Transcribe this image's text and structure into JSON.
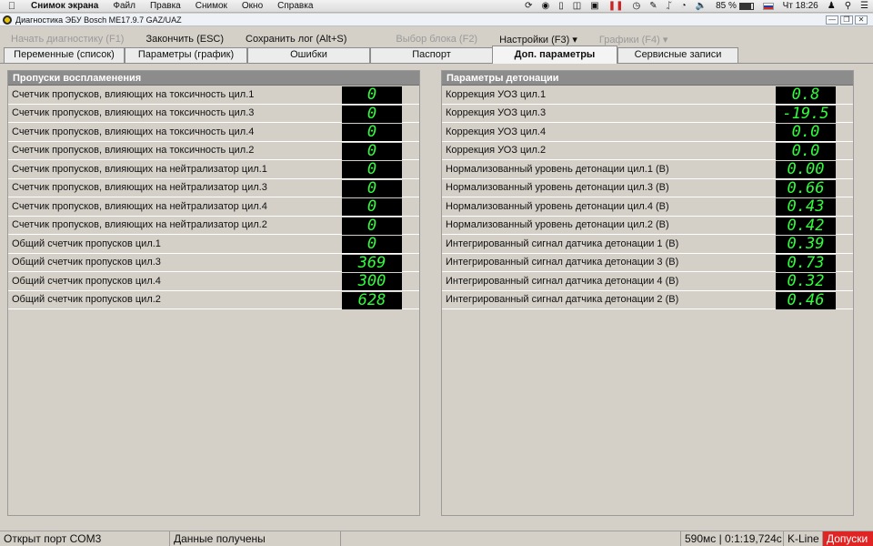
{
  "menubar": {
    "app_name": "Снимок экрана",
    "items": [
      "Файл",
      "Правка",
      "Снимок",
      "Окно",
      "Справка"
    ],
    "battery": "85 %",
    "clock": "Чт 18:26"
  },
  "window": {
    "title": "Диагностика ЭБУ Bosch ME17.9.7 GAZ/UAZ"
  },
  "toolbar": {
    "start_diag": "Начать диагностику (F1)",
    "finish": "Закончить (ESC)",
    "save_log": "Сохранить лог (Alt+S)",
    "select_block": "Выбор блока (F2)",
    "settings": "Настройки (F3)",
    "graphs": "Графики (F4)"
  },
  "tabs": [
    "Переменные (список)",
    "Параметры (график)",
    "Ошибки",
    "Паспорт",
    "Доп. параметры",
    "Сервисные записи"
  ],
  "active_tab": "Доп. параметры",
  "left_panel": {
    "title": "Пропуски воспламенения",
    "rows": [
      {
        "label": "Счетчик пропусков, влияющих на токсичность цил.1",
        "value": "0"
      },
      {
        "label": "Счетчик пропусков, влияющих на токсичность цил.3",
        "value": "0"
      },
      {
        "label": "Счетчик пропусков, влияющих на токсичность цил.4",
        "value": "0"
      },
      {
        "label": "Счетчик пропусков, влияющих на токсичность цил.2",
        "value": "0"
      },
      {
        "label": "Счетчик пропусков, влияющих на нейтрализатор цил.1",
        "value": "0"
      },
      {
        "label": "Счетчик пропусков, влияющих на нейтрализатор цил.3",
        "value": "0"
      },
      {
        "label": "Счетчик пропусков, влияющих на нейтрализатор цил.4",
        "value": "0"
      },
      {
        "label": "Счетчик пропусков, влияющих на нейтрализатор цил.2",
        "value": "0"
      },
      {
        "label": "Общий счетчик пропусков цил.1",
        "value": "0"
      },
      {
        "label": "Общий счетчик пропусков цил.3",
        "value": "369"
      },
      {
        "label": "Общий счетчик пропусков цил.4",
        "value": "300"
      },
      {
        "label": "Общий счетчик пропусков цил.2",
        "value": "628"
      }
    ]
  },
  "right_panel": {
    "title": "Параметры детонации",
    "rows": [
      {
        "label": "Коррекция УОЗ цил.1",
        "value": "0.8"
      },
      {
        "label": "Коррекция УОЗ цил.3",
        "value": "-19.5"
      },
      {
        "label": "Коррекция УОЗ цил.4",
        "value": "0.0"
      },
      {
        "label": "Коррекция УОЗ цил.2",
        "value": "0.0"
      },
      {
        "label": "Нормализованный уровень детонации цил.1 (В)",
        "value": "0.00"
      },
      {
        "label": "Нормализованный уровень детонации цил.3 (В)",
        "value": "0.66"
      },
      {
        "label": "Нормализованный уровень детонации цил.4 (В)",
        "value": "0.43"
      },
      {
        "label": "Нормализованный уровень детонации цил.2 (В)",
        "value": "0.42"
      },
      {
        "label": "Интегрированный сигнал датчика детонации 1 (В)",
        "value": "0.39"
      },
      {
        "label": "Интегрированный сигнал датчика детонации 3 (В)",
        "value": "0.73"
      },
      {
        "label": "Интегрированный сигнал датчика детонации 4 (В)",
        "value": "0.32"
      },
      {
        "label": "Интегрированный сигнал датчика детонации 2 (В)",
        "value": "0.46"
      }
    ]
  },
  "statusbar": {
    "port": "Открыт порт COM3",
    "data": "Данные получены",
    "empty": "",
    "timing": "590мс | 0:1:19,724с",
    "protocol": "K-Line",
    "tolerances": "Допуски"
  },
  "colors": {
    "digit_green": "#2fff3b",
    "panel_header": "#8c8c8c",
    "tolerances_red": "#e02424"
  }
}
